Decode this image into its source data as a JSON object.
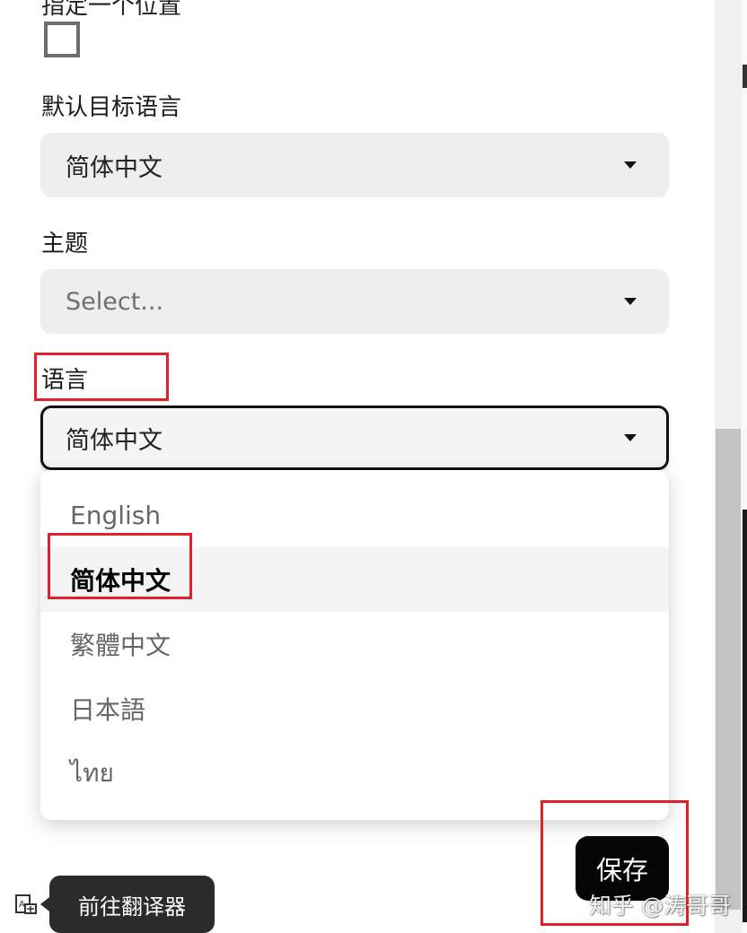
{
  "settings": {
    "checkbox_section_label": "指定一个位置",
    "default_target_language": {
      "label": "默认目标语言",
      "value": "简体中文"
    },
    "theme": {
      "label": "主题",
      "placeholder": "Select..."
    },
    "language": {
      "label": "语言",
      "value": "简体中文",
      "options": [
        "English",
        "简体中文",
        "繁體中文",
        "日本語",
        "ไทย"
      ],
      "selected_index": 1
    },
    "save_label": "保存"
  },
  "footer": {
    "translator_link_label": "前往翻译器",
    "watermark": "知乎 @涛哥哥"
  },
  "colors": {
    "highlight": "#e0202a",
    "save_bg": "#050505",
    "select_bg": "#eeeeee"
  },
  "icons": {
    "translator": "translate-icon",
    "caret": "caret-down-icon"
  }
}
